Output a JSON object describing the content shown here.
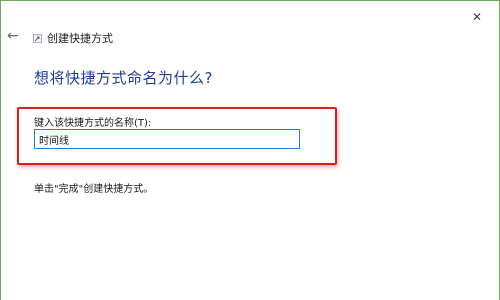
{
  "window": {
    "title": "创建快捷方式",
    "close_glyph": "✕",
    "back_glyph": "←"
  },
  "main": {
    "heading": "想将快捷方式命名为什么?",
    "name_label": "键入该快捷方式的名称(T):",
    "name_value": "时间线",
    "hint": "单击\"完成\"创建快捷方式。"
  },
  "icons": {
    "back": "back-arrow-icon",
    "wizard": "shortcut-wizard-icon",
    "close": "close-icon"
  },
  "colors": {
    "heading": "#1f3d96",
    "highlight": "#d81f1f",
    "input_border": "#2e78d4",
    "window_border": "#6faa5a"
  }
}
